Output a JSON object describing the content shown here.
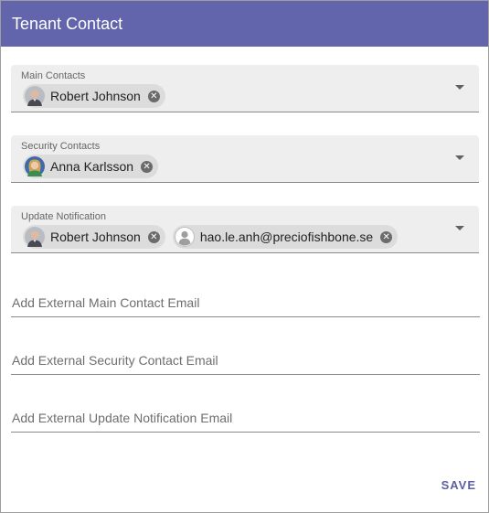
{
  "dialog": {
    "title": "Tenant Contact",
    "header_color": "#6365ac"
  },
  "main_contacts": {
    "label": "Main Contacts",
    "chips": [
      {
        "name": "Robert Johnson",
        "avatar": "robert-photo"
      }
    ]
  },
  "security_contacts": {
    "label": "Security Contacts",
    "chips": [
      {
        "name": "Anna Karlsson",
        "avatar": "anna-photo"
      }
    ]
  },
  "update_notification": {
    "label": "Update Notification",
    "chips": [
      {
        "name": "Robert Johnson",
        "avatar": "robert-photo"
      },
      {
        "name": "hao.le.anh@preciofishbone.se",
        "avatar": "default-person-icon"
      }
    ]
  },
  "external": {
    "main_placeholder": "Add External Main Contact Email",
    "security_placeholder": "Add External Security Contact Email",
    "update_placeholder": "Add External Update Notification Email"
  },
  "actions": {
    "save_label": "SAVE"
  }
}
